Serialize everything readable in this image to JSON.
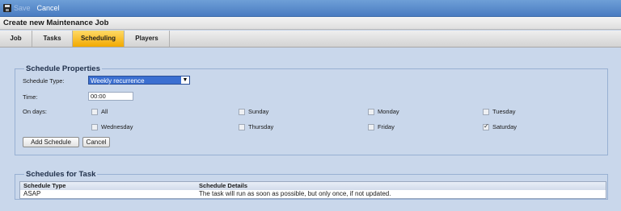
{
  "toolbar": {
    "save_label": "Save",
    "cancel_label": "Cancel"
  },
  "title": "Create new Maintenance Job",
  "tabs": [
    {
      "label": "Job",
      "active": false
    },
    {
      "label": "Tasks",
      "active": false
    },
    {
      "label": "Scheduling",
      "active": true
    },
    {
      "label": "Players",
      "active": false
    }
  ],
  "schedule_properties": {
    "legend": "Schedule Properties",
    "schedule_type_label": "Schedule Type:",
    "schedule_type_value": "Weekly recurrence",
    "time_label": "Time:",
    "time_value": "00:00",
    "on_days_label": "On days:",
    "days": [
      {
        "label": "All",
        "checked": false
      },
      {
        "label": "Sunday",
        "checked": false
      },
      {
        "label": "Monday",
        "checked": false
      },
      {
        "label": "Tuesday",
        "checked": false
      },
      {
        "label": "Wednesday",
        "checked": false
      },
      {
        "label": "Thursday",
        "checked": false
      },
      {
        "label": "Friday",
        "checked": false
      },
      {
        "label": "Saturday",
        "checked": true
      }
    ],
    "add_button": "Add Schedule",
    "cancel_button": "Cancel"
  },
  "schedules_for_task": {
    "legend": "Schedules for Task",
    "columns": [
      "Schedule Type",
      "Schedule Details"
    ],
    "rows": [
      [
        "ASAP",
        "The task will run as soon as possible, but only once, if not updated."
      ]
    ]
  },
  "colors": {
    "accent_tab": "#f2a900",
    "select_bg": "#3b6fd1",
    "panel_bg": "#c9d7eb"
  }
}
